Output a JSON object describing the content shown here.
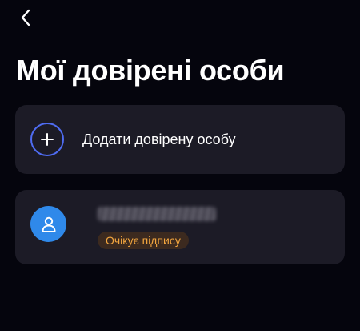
{
  "header": {
    "back_icon": "chevron-left-icon"
  },
  "page": {
    "title": "Мої довірені особи"
  },
  "add_card": {
    "icon": "plus-icon",
    "label": "Додати довірену особу"
  },
  "person_card": {
    "avatar_icon": "person-icon",
    "name_redacted": true,
    "status": "Очікує підпису"
  },
  "colors": {
    "background": "#05050d",
    "card": "#1c1b26",
    "accent_outline": "#4f6cf2",
    "avatar": "#2f89ea",
    "status_text": "#f3a63f",
    "status_bg": "#3c2a1f"
  }
}
